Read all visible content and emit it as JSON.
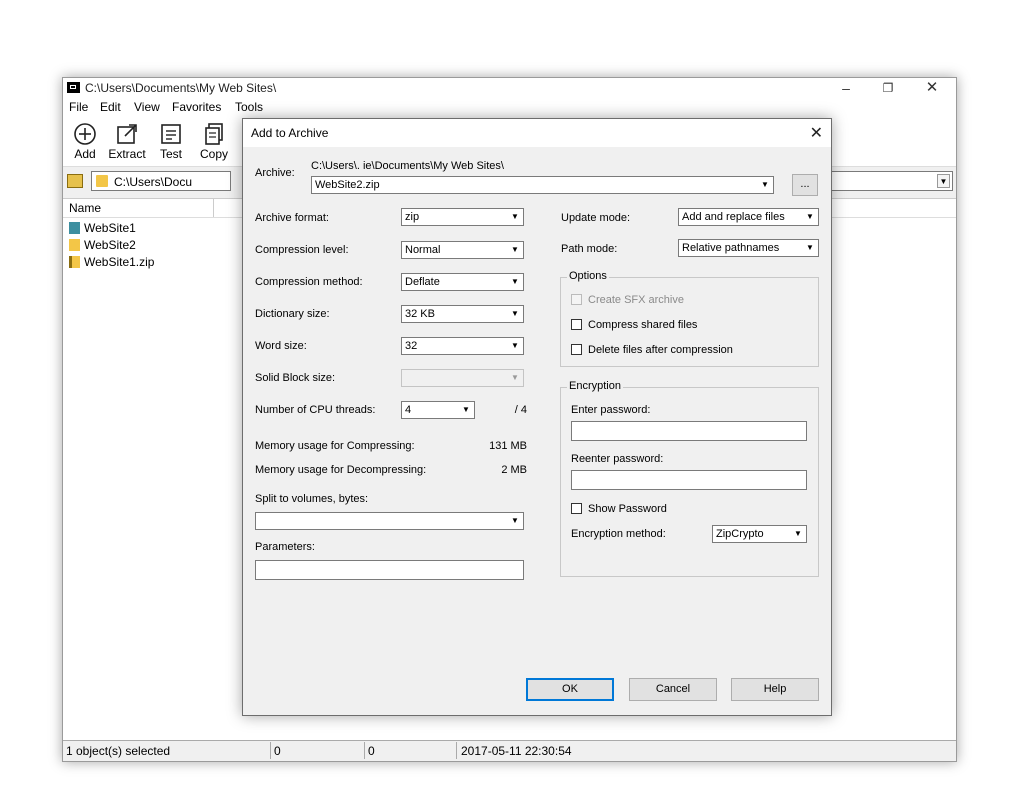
{
  "window": {
    "title": "C:\\Users\\Documents\\My Web Sites\\",
    "controls": {
      "minimize": "–",
      "maximize": "❐",
      "close": "✕"
    }
  },
  "menu": [
    "File",
    "Edit",
    "View",
    "Favorites",
    "Tools"
  ],
  "toolbar": {
    "add": "Add",
    "extract": "Extract",
    "test": "Test",
    "copy": "Copy"
  },
  "address": {
    "path": "C:\\Users\\Docu"
  },
  "filelist": {
    "header": "Name",
    "files": [
      "WebSite1",
      "WebSite2",
      "WebSite1.zip"
    ]
  },
  "status": {
    "selected": "1 object(s) selected",
    "size": "0",
    "packed": "0",
    "modified": "2017-05-11 22:30:54"
  },
  "dialog": {
    "title": "Add to Archive",
    "close": "✕",
    "archive_label": "Archive:",
    "archive_dir": "C:\\Users\\.       ie\\Documents\\My Web Sites\\",
    "archive_name": "WebSite2.zip",
    "browse": "...",
    "archive_format_label": "Archive format:",
    "archive_format": "zip",
    "compression_level_label": "Compression level:",
    "compression_level": "Normal",
    "compression_method_label": "Compression method:",
    "compression_method": "Deflate",
    "dictionary_size_label": "Dictionary size:",
    "dictionary_size": "32 KB",
    "word_size_label": "Word size:",
    "word_size": "32",
    "solid_block_label": "Solid Block size:",
    "solid_block": "",
    "cpu_threads_label": "Number of CPU threads:",
    "cpu_threads": "4",
    "cpu_threads_max": "/ 4",
    "mem_compress_label": "Memory usage for Compressing:",
    "mem_compress": "131 MB",
    "mem_decompress_label": "Memory usage for Decompressing:",
    "mem_decompress": "2 MB",
    "split_label": "Split to volumes, bytes:",
    "split_value": "",
    "parameters_label": "Parameters:",
    "update_mode_label": "Update mode:",
    "update_mode": "Add and replace files",
    "path_mode_label": "Path mode:",
    "path_mode": "Relative pathnames",
    "options_title": "Options",
    "opt_sfx": "Create SFX archive",
    "opt_shared": "Compress shared files",
    "opt_delete": "Delete files after compression",
    "encryption_title": "Encryption",
    "enter_password_label": "Enter password:",
    "reenter_password_label": "Reenter password:",
    "show_password": "Show Password",
    "encryption_method_label": "Encryption method:",
    "encryption_method": "ZipCrypto",
    "ok": "OK",
    "cancel": "Cancel",
    "help": "Help"
  },
  "icons": {
    "dropdown": "▼"
  }
}
